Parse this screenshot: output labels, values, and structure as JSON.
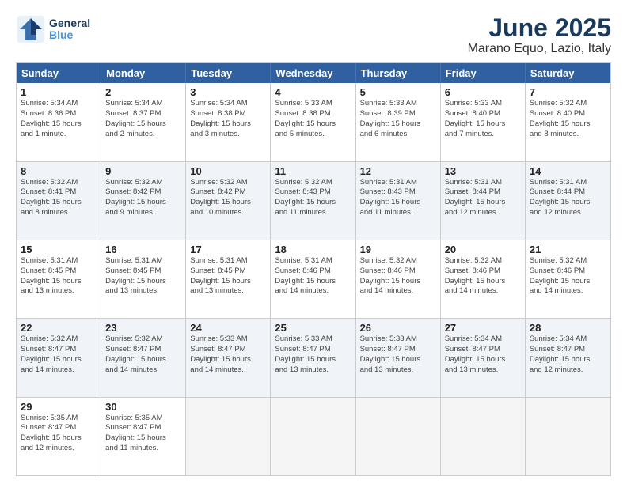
{
  "logo": {
    "line1": "General",
    "line2": "Blue"
  },
  "title": "June 2025",
  "subtitle": "Marano Equo, Lazio, Italy",
  "header_days": [
    "Sunday",
    "Monday",
    "Tuesday",
    "Wednesday",
    "Thursday",
    "Friday",
    "Saturday"
  ],
  "rows": [
    [
      {
        "day": "1",
        "info": "Sunrise: 5:34 AM\nSunset: 8:36 PM\nDaylight: 15 hours\nand 1 minute."
      },
      {
        "day": "2",
        "info": "Sunrise: 5:34 AM\nSunset: 8:37 PM\nDaylight: 15 hours\nand 2 minutes."
      },
      {
        "day": "3",
        "info": "Sunrise: 5:34 AM\nSunset: 8:38 PM\nDaylight: 15 hours\nand 3 minutes."
      },
      {
        "day": "4",
        "info": "Sunrise: 5:33 AM\nSunset: 8:38 PM\nDaylight: 15 hours\nand 5 minutes."
      },
      {
        "day": "5",
        "info": "Sunrise: 5:33 AM\nSunset: 8:39 PM\nDaylight: 15 hours\nand 6 minutes."
      },
      {
        "day": "6",
        "info": "Sunrise: 5:33 AM\nSunset: 8:40 PM\nDaylight: 15 hours\nand 7 minutes."
      },
      {
        "day": "7",
        "info": "Sunrise: 5:32 AM\nSunset: 8:40 PM\nDaylight: 15 hours\nand 8 minutes."
      }
    ],
    [
      {
        "day": "8",
        "info": "Sunrise: 5:32 AM\nSunset: 8:41 PM\nDaylight: 15 hours\nand 8 minutes."
      },
      {
        "day": "9",
        "info": "Sunrise: 5:32 AM\nSunset: 8:42 PM\nDaylight: 15 hours\nand 9 minutes."
      },
      {
        "day": "10",
        "info": "Sunrise: 5:32 AM\nSunset: 8:42 PM\nDaylight: 15 hours\nand 10 minutes."
      },
      {
        "day": "11",
        "info": "Sunrise: 5:32 AM\nSunset: 8:43 PM\nDaylight: 15 hours\nand 11 minutes."
      },
      {
        "day": "12",
        "info": "Sunrise: 5:31 AM\nSunset: 8:43 PM\nDaylight: 15 hours\nand 11 minutes."
      },
      {
        "day": "13",
        "info": "Sunrise: 5:31 AM\nSunset: 8:44 PM\nDaylight: 15 hours\nand 12 minutes."
      },
      {
        "day": "14",
        "info": "Sunrise: 5:31 AM\nSunset: 8:44 PM\nDaylight: 15 hours\nand 12 minutes."
      }
    ],
    [
      {
        "day": "15",
        "info": "Sunrise: 5:31 AM\nSunset: 8:45 PM\nDaylight: 15 hours\nand 13 minutes."
      },
      {
        "day": "16",
        "info": "Sunrise: 5:31 AM\nSunset: 8:45 PM\nDaylight: 15 hours\nand 13 minutes."
      },
      {
        "day": "17",
        "info": "Sunrise: 5:31 AM\nSunset: 8:45 PM\nDaylight: 15 hours\nand 13 minutes."
      },
      {
        "day": "18",
        "info": "Sunrise: 5:31 AM\nSunset: 8:46 PM\nDaylight: 15 hours\nand 14 minutes."
      },
      {
        "day": "19",
        "info": "Sunrise: 5:32 AM\nSunset: 8:46 PM\nDaylight: 15 hours\nand 14 minutes."
      },
      {
        "day": "20",
        "info": "Sunrise: 5:32 AM\nSunset: 8:46 PM\nDaylight: 15 hours\nand 14 minutes."
      },
      {
        "day": "21",
        "info": "Sunrise: 5:32 AM\nSunset: 8:46 PM\nDaylight: 15 hours\nand 14 minutes."
      }
    ],
    [
      {
        "day": "22",
        "info": "Sunrise: 5:32 AM\nSunset: 8:47 PM\nDaylight: 15 hours\nand 14 minutes."
      },
      {
        "day": "23",
        "info": "Sunrise: 5:32 AM\nSunset: 8:47 PM\nDaylight: 15 hours\nand 14 minutes."
      },
      {
        "day": "24",
        "info": "Sunrise: 5:33 AM\nSunset: 8:47 PM\nDaylight: 15 hours\nand 14 minutes."
      },
      {
        "day": "25",
        "info": "Sunrise: 5:33 AM\nSunset: 8:47 PM\nDaylight: 15 hours\nand 13 minutes."
      },
      {
        "day": "26",
        "info": "Sunrise: 5:33 AM\nSunset: 8:47 PM\nDaylight: 15 hours\nand 13 minutes."
      },
      {
        "day": "27",
        "info": "Sunrise: 5:34 AM\nSunset: 8:47 PM\nDaylight: 15 hours\nand 13 minutes."
      },
      {
        "day": "28",
        "info": "Sunrise: 5:34 AM\nSunset: 8:47 PM\nDaylight: 15 hours\nand 12 minutes."
      }
    ],
    [
      {
        "day": "29",
        "info": "Sunrise: 5:35 AM\nSunset: 8:47 PM\nDaylight: 15 hours\nand 12 minutes."
      },
      {
        "day": "30",
        "info": "Sunrise: 5:35 AM\nSunset: 8:47 PM\nDaylight: 15 hours\nand 11 minutes."
      },
      {
        "day": "",
        "info": ""
      },
      {
        "day": "",
        "info": ""
      },
      {
        "day": "",
        "info": ""
      },
      {
        "day": "",
        "info": ""
      },
      {
        "day": "",
        "info": ""
      }
    ]
  ]
}
